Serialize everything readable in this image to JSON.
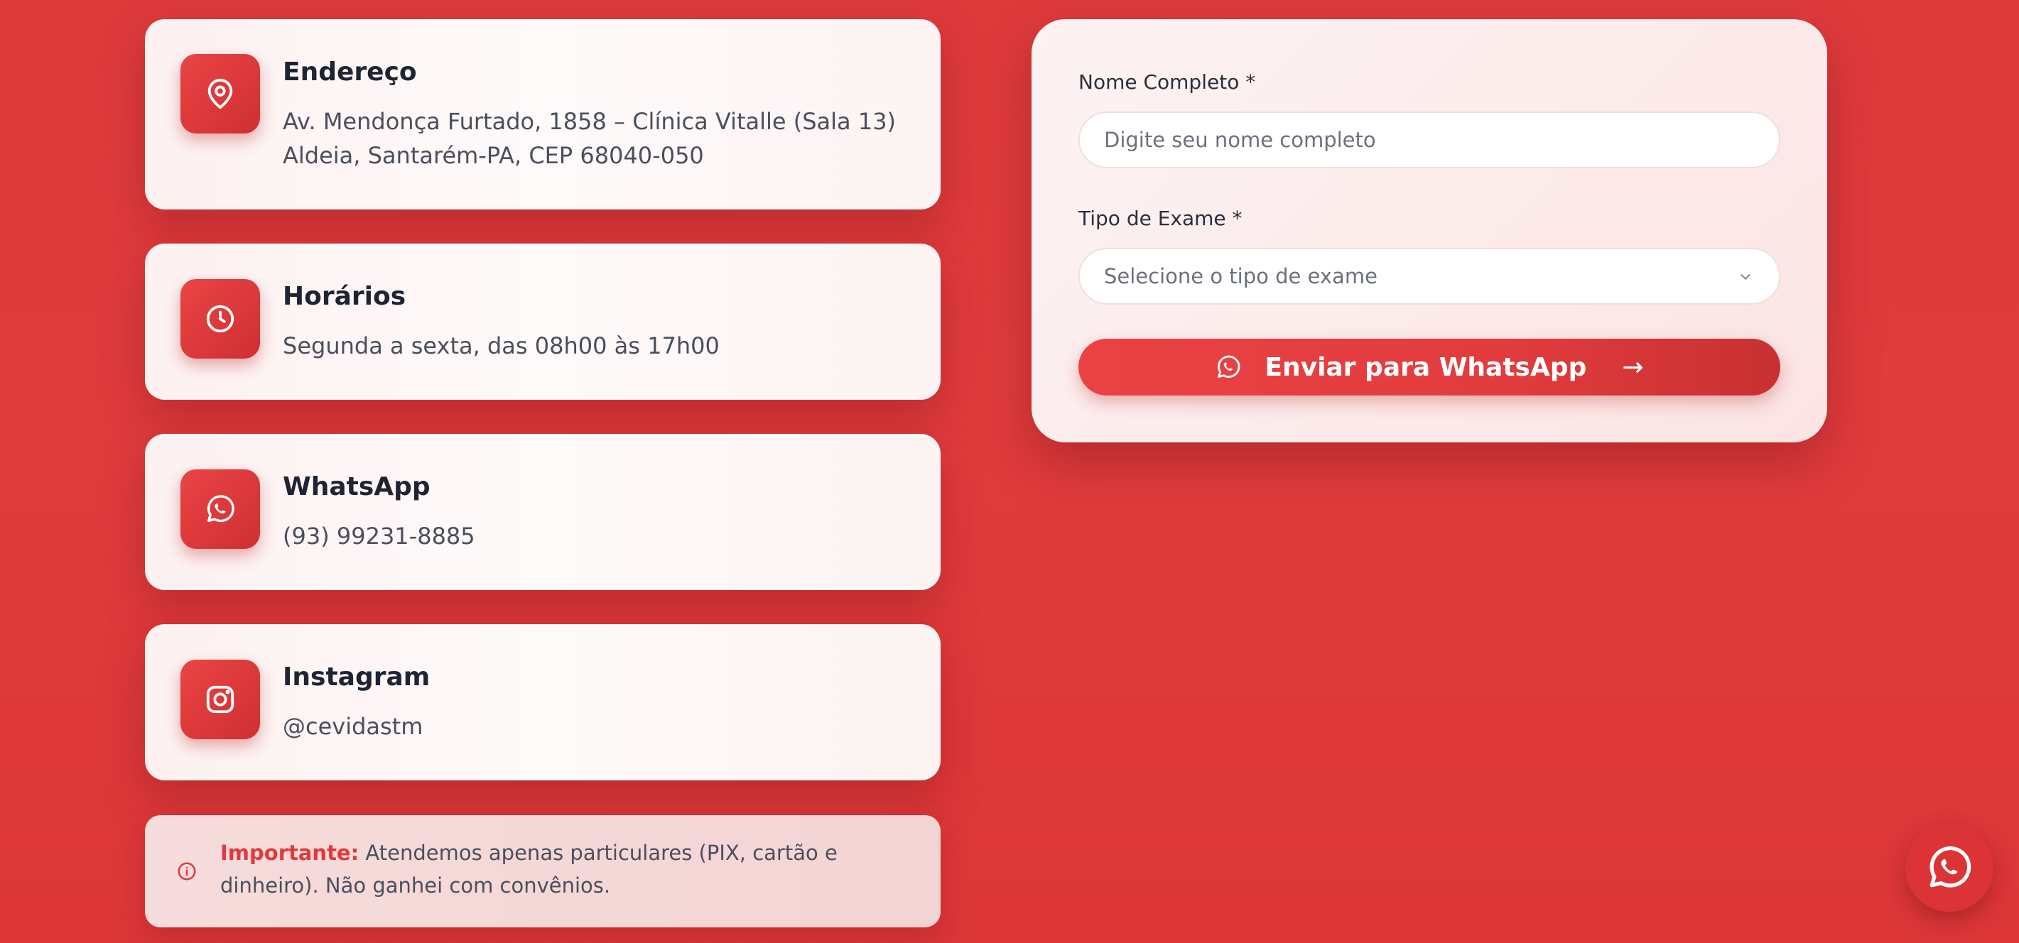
{
  "contact_cards": [
    {
      "icon": "map-pin-icon",
      "title": "Endereço",
      "lines": [
        "Av. Mendonça Furtado, 1858 – Clínica Vitalle (Sala 13)",
        "Aldeia, Santarém-PA, CEP 68040-050"
      ]
    },
    {
      "icon": "clock-icon",
      "title": "Horários",
      "lines": [
        "Segunda a sexta, das 08h00 às 17h00"
      ]
    },
    {
      "icon": "whatsapp-icon",
      "title": "WhatsApp",
      "lines": [
        "(93) 99231-8885"
      ]
    },
    {
      "icon": "instagram-icon",
      "title": "Instagram",
      "lines": [
        "@cevidastm"
      ]
    }
  ],
  "notice": {
    "icon": "info-icon",
    "strong": "Importante:",
    "text": " Atendemos apenas particulares (PIX, cartão e dinheiro). Não ganhei com convênios."
  },
  "form": {
    "name_label": "Nome Completo *",
    "name_placeholder": "Digite seu nome completo",
    "exam_label": "Tipo de Exame *",
    "exam_selected": "Selecione o tipo de exame",
    "submit_label": "Enviar para WhatsApp",
    "submit_arrow": "→"
  },
  "fab": {
    "icon": "whatsapp-icon"
  },
  "colors": {
    "accent": "#e23a3c",
    "background": "#de3a3c",
    "card": "#fefafa",
    "title_text": "#1e2433",
    "body_text": "#4a4f5c"
  }
}
